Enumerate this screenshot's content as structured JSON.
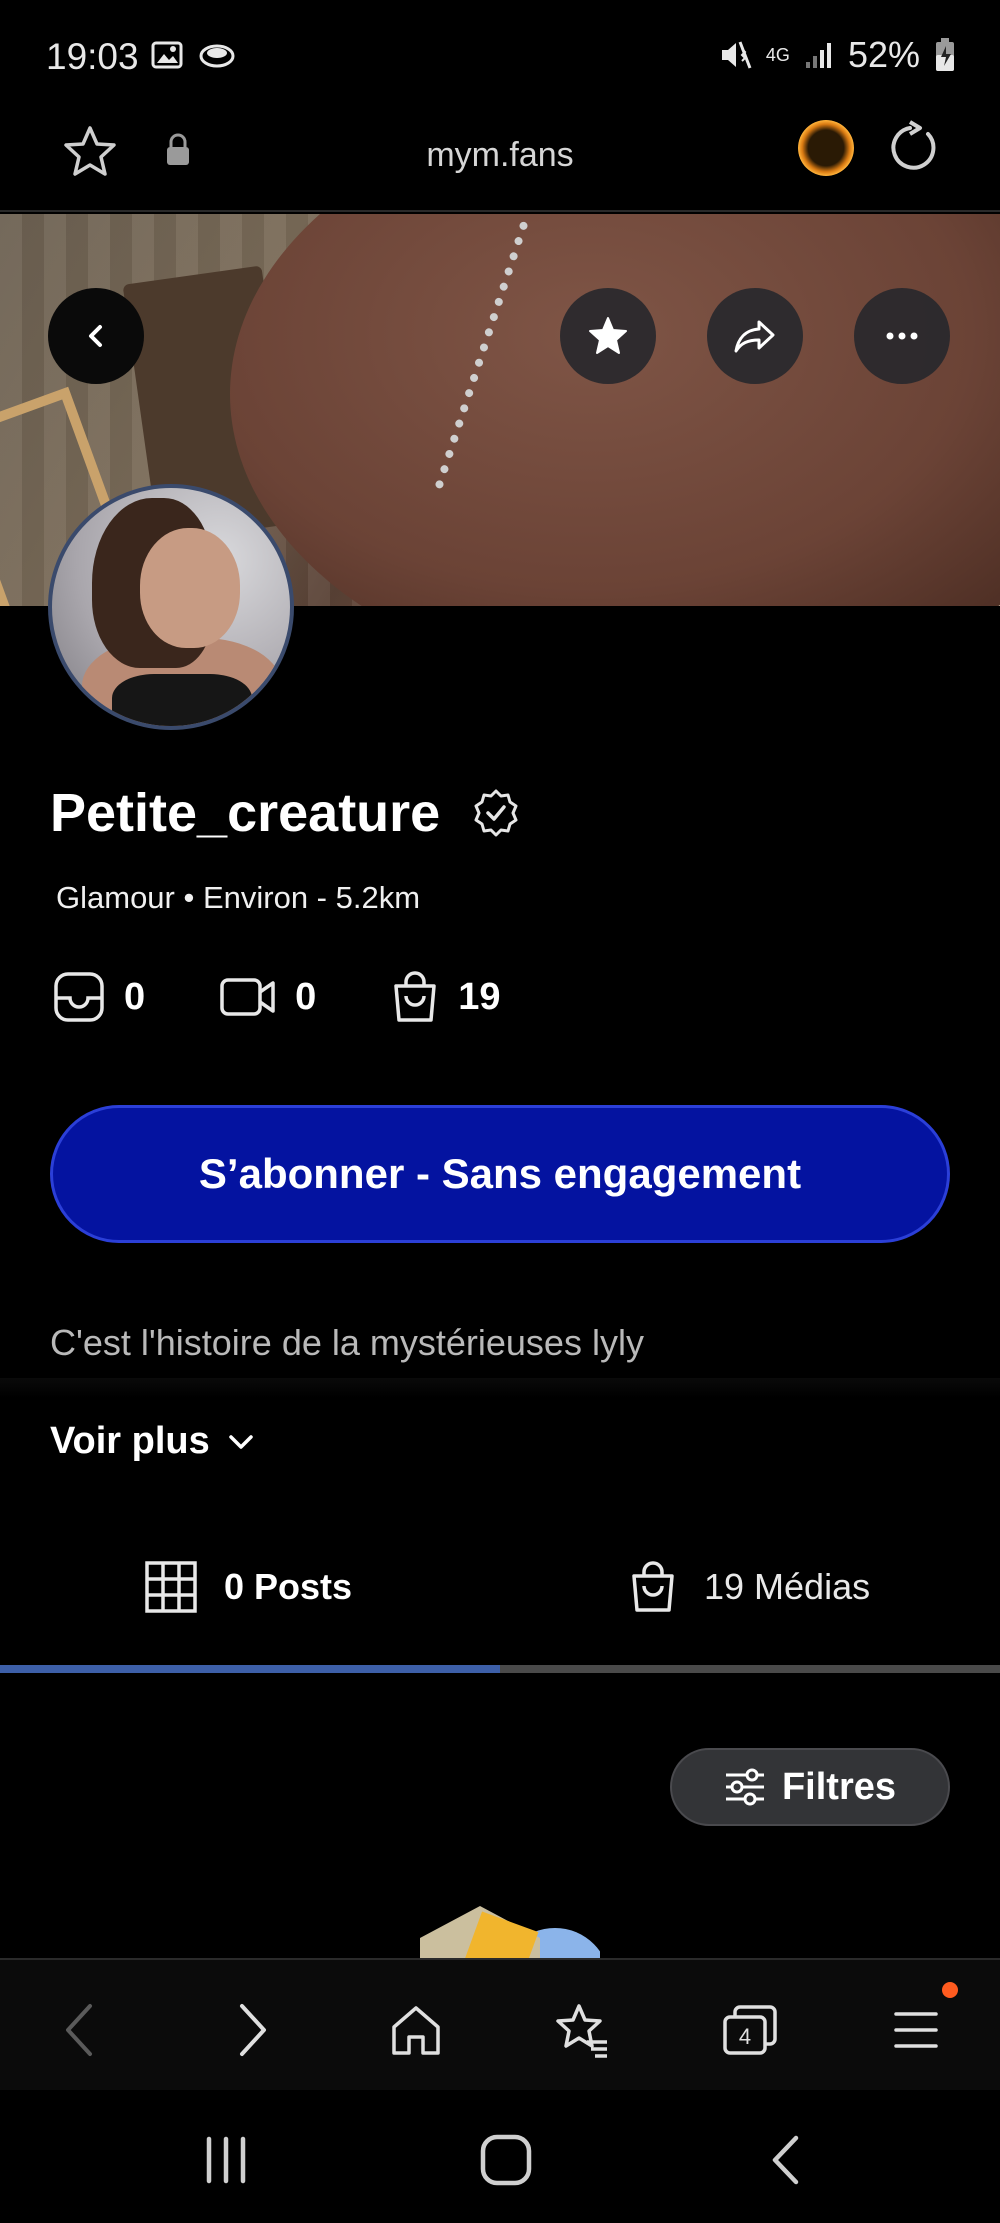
{
  "status_bar": {
    "time": "19:03",
    "battery": "52%",
    "network": "4G"
  },
  "browser": {
    "url": "mym.fans",
    "icons": [
      "star-outline-icon",
      "lock-icon",
      "site-avatar-icon",
      "refresh-icon"
    ]
  },
  "cover": {
    "buttons": [
      "back-icon",
      "favorite-star-icon",
      "share-icon",
      "more-icon"
    ]
  },
  "profile": {
    "username": "Petite_creature",
    "verified": true,
    "subline": "Glamour • Environ - 5.2km",
    "stats": [
      {
        "icon": "message-icon",
        "value": "0"
      },
      {
        "icon": "video-icon",
        "value": "0"
      },
      {
        "icon": "shopping-bag-icon",
        "value": "19"
      }
    ],
    "subscribe_label": "S’abonner - Sans engagement",
    "bio": "C'est l'histoire de la mystérieuses lyly",
    "see_more_label": "Voir plus"
  },
  "tabs": {
    "posts_label": "0 Posts",
    "medias_label": "19 Médias",
    "active": "posts"
  },
  "filters_label": "Filtres",
  "browser_nav": [
    "back-icon",
    "forward-icon",
    "home-icon",
    "bookmarks-icon",
    "tabs-icon",
    "menu-icon"
  ],
  "tab_count": "4",
  "colors": {
    "background": "#000000",
    "subscribe_bg": "#0413a0",
    "tab_active": "#3d5fa8",
    "notification_dot": "#ff5b1f"
  }
}
